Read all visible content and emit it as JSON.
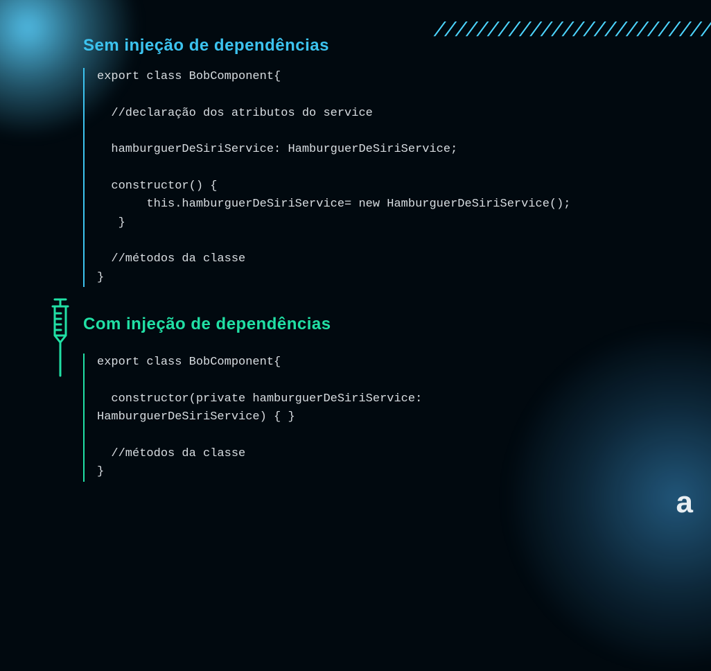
{
  "decor": {
    "slashes": "//////////////////////////"
  },
  "section1": {
    "heading": "Sem injeção de dependências",
    "code": "export class BobComponent{\n\n  //declaração dos atributos do service\n\n  hamburguerDeSiriService: HamburguerDeSiriService;\n\n  constructor() {\n       this.hamburguerDeSiriService= new HamburguerDeSiriService();\n   }\n\n  //métodos da classe\n}"
  },
  "section2": {
    "heading": "Com injeção de dependências",
    "code": "export class BobComponent{\n\n  constructor(private hamburguerDeSiriService:\nHamburguerDeSiriService) { }\n\n  //métodos da classe\n}"
  },
  "logo": {
    "letter": "a"
  }
}
